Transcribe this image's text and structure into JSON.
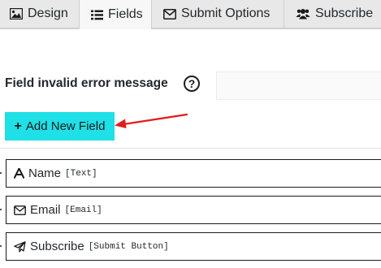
{
  "tabs": [
    {
      "label": "Design",
      "icon": "image-icon",
      "active": false
    },
    {
      "label": "Fields",
      "icon": "list-icon",
      "active": true
    },
    {
      "label": "Submit Options",
      "icon": "envelope-icon",
      "active": false
    },
    {
      "label": "Subscribe",
      "icon": "users-icon",
      "active": false
    }
  ],
  "error_message": {
    "label": "Field invalid error message",
    "help": "?",
    "value": ""
  },
  "add_button": {
    "icon": "+",
    "label": "Add New Field",
    "color": "#1ee0e6"
  },
  "annotation": {
    "arrow_color": "#e21b1b"
  },
  "fields": [
    {
      "icon": "text-icon",
      "name": "Name",
      "type": "[Text]"
    },
    {
      "icon": "envelope-icon",
      "name": "Email",
      "type": "[Email]"
    },
    {
      "icon": "paper-plane-icon",
      "name": "Subscribe",
      "type": "[Submit Button]"
    }
  ]
}
